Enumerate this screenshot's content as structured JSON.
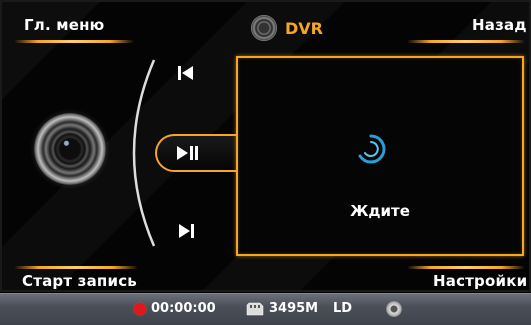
{
  "header": {
    "menu_label": "Гл. меню",
    "title": "DVR",
    "back_label": "Назад"
  },
  "controls": {
    "prev_icon": "skip-previous-icon",
    "play_pause_icon": "play-pause-icon",
    "next_icon": "skip-next-icon"
  },
  "video": {
    "status_text": "Ждите",
    "loading_icon": "loading-spinner-icon"
  },
  "footer": {
    "record_label": "Старт запись",
    "settings_label": "Настройки"
  },
  "statusbar": {
    "rec_time": "00:00:00",
    "storage": "3495M",
    "quality": "LD"
  },
  "colors": {
    "accent": "#f5a623",
    "record": "#e01818",
    "spinner": "#2a9fd6"
  }
}
